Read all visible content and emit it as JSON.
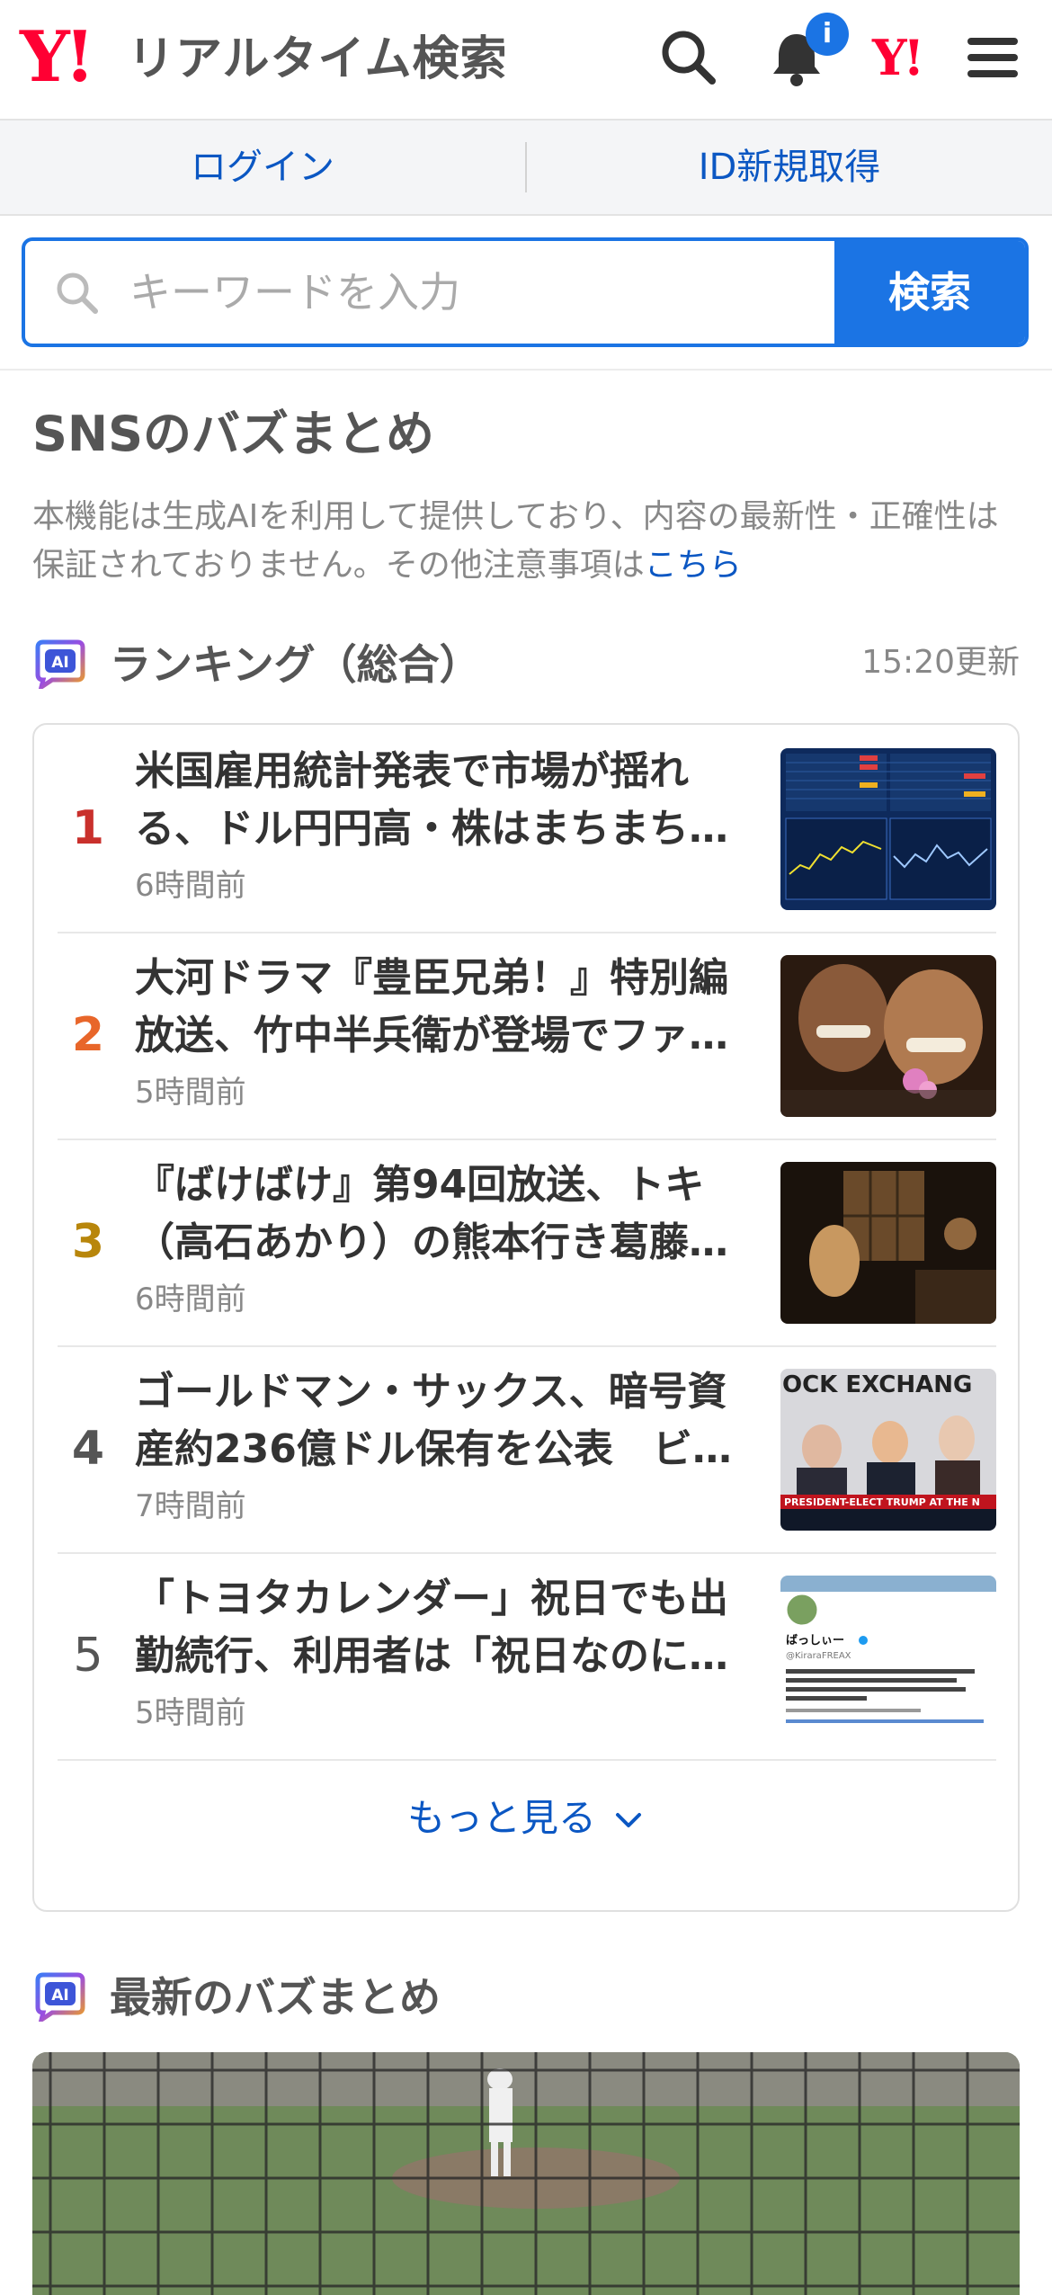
{
  "header": {
    "logo_mark": "Y!",
    "logo_text": "リアルタイム検索",
    "notification_count": "i",
    "yahoo_mark": "Y!"
  },
  "auth": {
    "login": "ログイン",
    "register": "ID新規取得"
  },
  "search": {
    "placeholder": "キーワードを入力",
    "button": "検索"
  },
  "buzz": {
    "title": "SNSのバズまとめ",
    "disclaimer": "本機能は生成AIを利用して提供しており、内容の最新性・正確性は保証されておりません。その他注意事項は",
    "disclaimer_link": "こちら"
  },
  "ranking": {
    "badge": "AI",
    "title": "ランキング（総合）",
    "updated": "15:20更新",
    "items": [
      {
        "rank": "1",
        "title": "米国雇用統計発表で市場が揺れる、ドル円円高・株はまちまち…",
        "time": "6時間前",
        "color": "#c9302c",
        "thumb": "stock-chart"
      },
      {
        "rank": "2",
        "title": "大河ドラマ『豊臣兄弟！』特別編放送、竹中半兵衛が登場でファ…",
        "time": "5時間前",
        "color": "#e8662a",
        "thumb": "drama-scene"
      },
      {
        "rank": "3",
        "title": "『ばけばけ』第94回放送、トキ（高石あかり）の熊本行き葛藤…",
        "time": "6時間前",
        "color": "#b8860b",
        "thumb": "period-room"
      },
      {
        "rank": "4",
        "title": "ゴールドマン・サックス、暗号資産約236億ドル保有を公表　ビ…",
        "time": "7時間前",
        "color": "#555555",
        "thumb": "stock-exchange-news"
      },
      {
        "rank": "5",
        "title": "「トヨタカレンダー」祝日でも出勤続行、利用者は「祝日なのに…",
        "time": "5時間前",
        "color": "#555555",
        "thumb": "social-post"
      }
    ],
    "more": "もっと見る"
  },
  "latest": {
    "badge": "AI",
    "title": "最新のバズまとめ"
  },
  "thumb_text": {
    "exchange": "OCK EXCHANG",
    "ticker": "PRESIDENT-ELECT TRUMP AT THE N",
    "tweet_name": "ばっしぃー",
    "tweet_handle": "@KiraraFREAX"
  },
  "colors": {
    "accent": "#1b74e4",
    "brand_red": "#ff0033",
    "link": "#0b57c3"
  }
}
